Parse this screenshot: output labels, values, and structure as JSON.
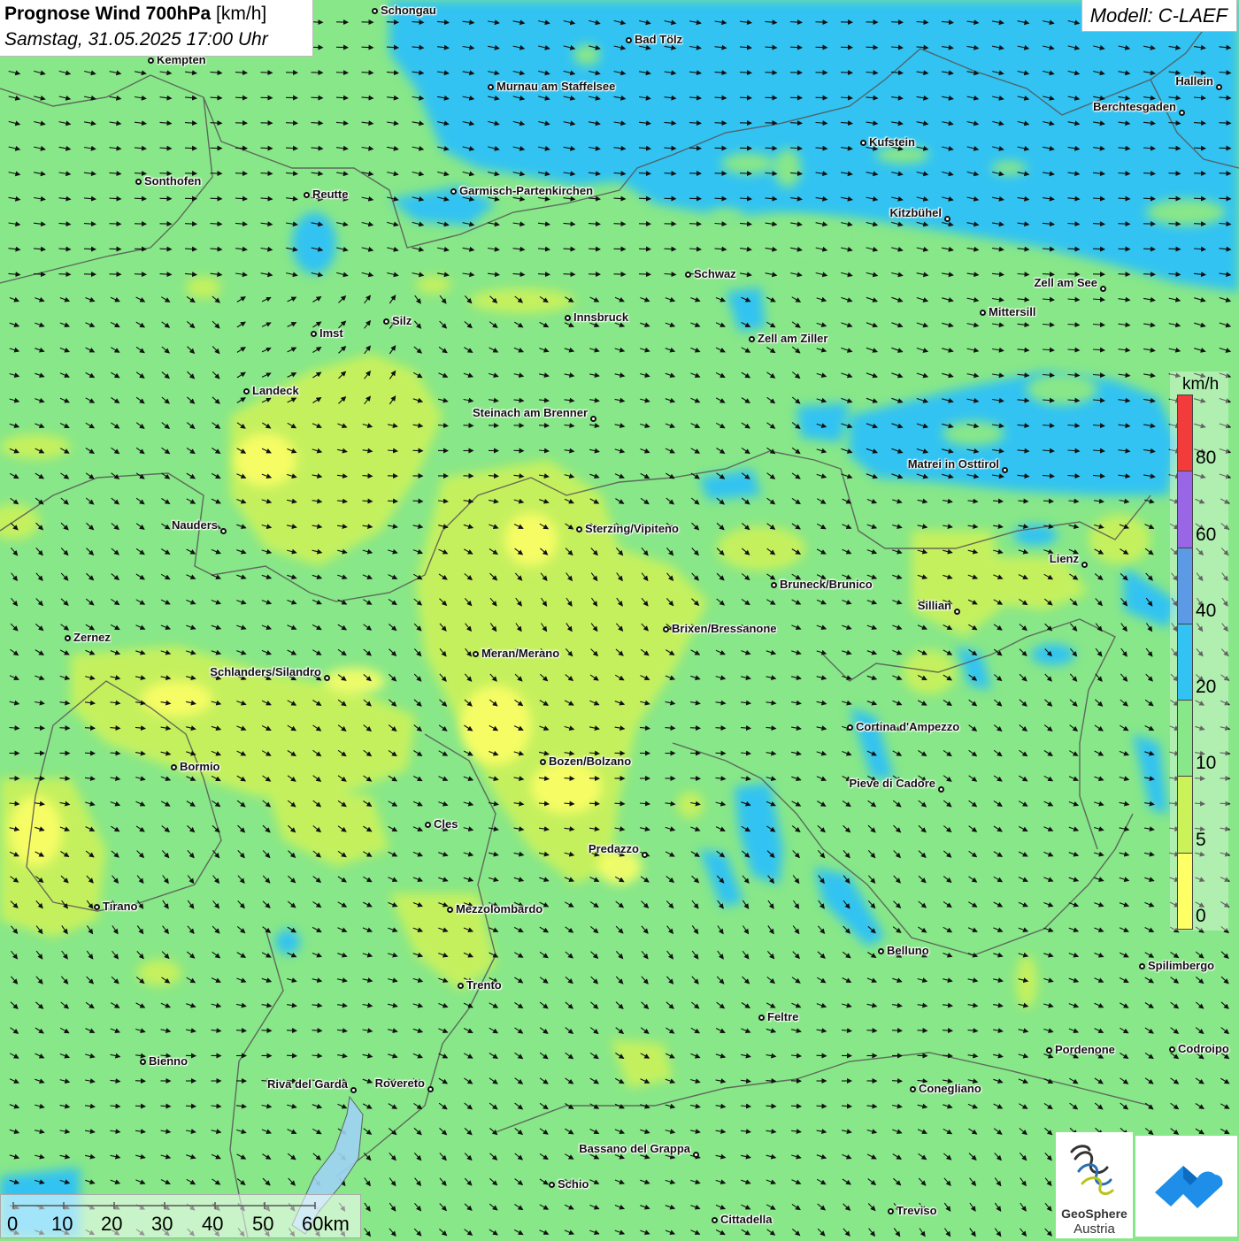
{
  "header": {
    "title_bold": "Prognose Wind 700hPa",
    "title_unit": " [km/h]",
    "date_time": "Samstag, 31.05.2025 17:00 Uhr"
  },
  "model": {
    "label": "Modell: C-LAEF"
  },
  "legend": {
    "unit": "km/h",
    "colors": [
      "#ffff66",
      "#ccf25a",
      "#88e788",
      "#33c3f2",
      "#5c9ae6",
      "#9966e6",
      "#f23b3b"
    ],
    "labels": [
      "0",
      "5",
      "10",
      "20",
      "40",
      "60",
      "80"
    ]
  },
  "scale_bar": {
    "labels": [
      "0",
      "10",
      "20",
      "30",
      "40",
      "50",
      "60km"
    ]
  },
  "logos": {
    "geosphere_line1": "GeoSphere",
    "geosphere_line2": "Austria"
  },
  "cities": [
    {
      "name": "Schongau"
    },
    {
      "name": "Bad Tölz"
    },
    {
      "name": "Kempten"
    },
    {
      "name": "Murnau am Staffelsee"
    },
    {
      "name": "Hallein"
    },
    {
      "name": "Berchtesgaden"
    },
    {
      "name": "Kufstein"
    },
    {
      "name": "Sonthofen"
    },
    {
      "name": "Reutte"
    },
    {
      "name": "Garmisch-Partenkirchen"
    },
    {
      "name": "Kitzbühel"
    },
    {
      "name": "Schwaz"
    },
    {
      "name": "Zell am See"
    },
    {
      "name": "Mittersill"
    },
    {
      "name": "Innsbruck"
    },
    {
      "name": "Silz"
    },
    {
      "name": "Imst"
    },
    {
      "name": "Zell am Ziller"
    },
    {
      "name": "Landeck"
    },
    {
      "name": "Steinach am Brenner"
    },
    {
      "name": "Matrei in Osttirol"
    },
    {
      "name": "Nauders"
    },
    {
      "name": "Sterzing/Vipiteno"
    },
    {
      "name": "Lienz"
    },
    {
      "name": "Bruneck/Brunico"
    },
    {
      "name": "Sillian"
    },
    {
      "name": "Brixen/Bressanone"
    },
    {
      "name": "Zernez"
    },
    {
      "name": "Meran/Merano"
    },
    {
      "name": "Schlanders/Silandro"
    },
    {
      "name": "Cortina d'Ampezzo"
    },
    {
      "name": "Bozen/Bolzano"
    },
    {
      "name": "Bormio"
    },
    {
      "name": "Pieve di Cadore"
    },
    {
      "name": "Cles"
    },
    {
      "name": "Predazzo"
    },
    {
      "name": "Tirano"
    },
    {
      "name": "Mezzolombardo"
    },
    {
      "name": "Belluno"
    },
    {
      "name": "Spilimbergo"
    },
    {
      "name": "Trento"
    },
    {
      "name": "Feltre"
    },
    {
      "name": "Bienno"
    },
    {
      "name": "Pordenone"
    },
    {
      "name": "Codroipo"
    },
    {
      "name": "Riva del Garda"
    },
    {
      "name": "Rovereto"
    },
    {
      "name": "Conegliano"
    },
    {
      "name": "Bassano del Grappa"
    },
    {
      "name": "Schio"
    },
    {
      "name": "Treviso"
    },
    {
      "name": "Cittadella"
    }
  ]
}
